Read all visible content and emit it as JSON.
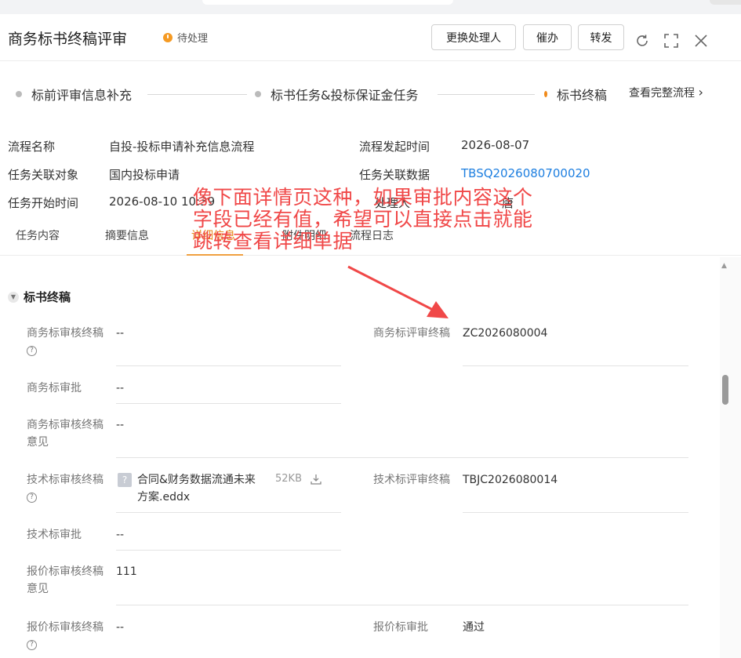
{
  "header": {
    "title": "商务标书终稿评审",
    "status": "待处理",
    "buttons": {
      "change_handler": "更换处理人",
      "urge": "催办",
      "forward": "转发"
    }
  },
  "steps": {
    "items": [
      "标前评审信息补充",
      "标书任务&投标保证金任务",
      "标书终稿"
    ],
    "full_flow_link": "查看完整流程"
  },
  "info": {
    "flow_name_label": "流程名称",
    "flow_name_value": "自投-投标申请补充信息流程",
    "flow_start_label": "流程发起时间",
    "flow_start_value": "2026-08-07",
    "related_object_label": "任务关联对象",
    "related_object_value": "国内投标申请",
    "related_data_label": "任务关联数据",
    "related_data_value": "TBSQ2026080700020",
    "task_start_label": "任务开始时间",
    "task_start_value": "2026-08-10 10:39",
    "handler_label": "处理人",
    "handler_value": "唐"
  },
  "subtabs": [
    "任务内容",
    "摘要信息",
    "详细信息",
    "附件明细",
    "流程日志"
  ],
  "section": {
    "title": "标书终稿",
    "fields": {
      "biz_review_final_label": "商务标审核终稿",
      "biz_review_final_value": "--",
      "biz_eval_final_label": "商务标评审终稿",
      "biz_eval_final_value": "ZC2026080004",
      "biz_approval_label": "商务标审批",
      "biz_approval_value": "--",
      "biz_review_opinion_label": "商务标审核终稿意见",
      "biz_review_opinion_value": "--",
      "tech_review_final_label": "技术标审核终稿",
      "tech_file_name": "合同&财务数据流通未来方案.eddx",
      "tech_file_size": "52KB",
      "tech_eval_final_label": "技术标评审终稿",
      "tech_eval_final_value": "TBJC2026080014",
      "tech_approval_label": "技术标审批",
      "tech_approval_value": "--",
      "quote_review_opinion_label": "报价标审核终稿意见",
      "quote_review_opinion_value": "111",
      "quote_review_final_label": "报价标审核终稿",
      "quote_review_final_value": "--",
      "quote_approval_label": "报价标审批",
      "quote_approval_value": "通过"
    }
  },
  "annotation": {
    "line1": "像下面详情页这种，如果审批内容这个",
    "line2": "字段已经有值，希望可以直接点击就能",
    "line3": "跳转查看详细单据"
  }
}
